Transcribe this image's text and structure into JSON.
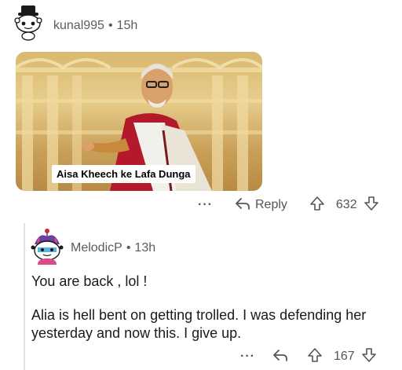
{
  "comment1": {
    "username": "kunal995",
    "age": "15h",
    "separator": "•",
    "meme_caption": "Aisa Kheech ke Lafa Dunga",
    "more": "···",
    "reply_label": "Reply",
    "upvote_count": "632"
  },
  "comment2": {
    "username": "MelodicP",
    "age": "13h",
    "separator": "•",
    "text_line1": "You are back , lol !",
    "text_paragraph": "Alia is hell bent on getting trolled. I was defending her yesterday and now this. I give up.",
    "more": "···",
    "upvote_count": "167"
  },
  "colors": {
    "meta_text": "#5c5c5c",
    "body_text": "#1a1a1a",
    "thread_line": "#e3e3e3"
  },
  "icons": [
    "snoo-avatar-icon",
    "reply-arrow-icon",
    "upvote-arrow-icon",
    "downvote-arrow-icon",
    "more-options-icon"
  ]
}
